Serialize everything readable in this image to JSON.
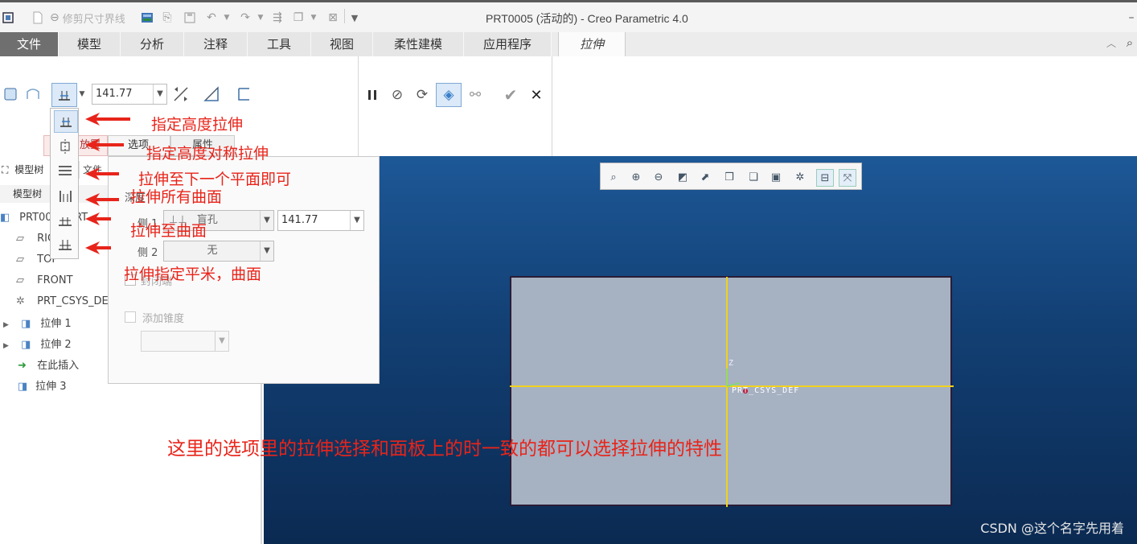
{
  "window": {
    "title": "PRT0005 (活动的) - Creo Parametric 4.0",
    "quick_access_text": "修剪尺寸界线"
  },
  "tabs": [
    {
      "label": "文件"
    },
    {
      "label": "模型"
    },
    {
      "label": "分析"
    },
    {
      "label": "注释"
    },
    {
      "label": "工具"
    },
    {
      "label": "视图"
    },
    {
      "label": "柔性建模"
    },
    {
      "label": "应用程序"
    },
    {
      "label": "拉伸"
    }
  ],
  "ribbon": {
    "depth_value": "141.77",
    "sub_tabs": [
      "放置",
      "选项",
      "属性"
    ]
  },
  "model_tree_header": {
    "title": "模型树",
    "files_tab": "文件",
    "label": "模型树"
  },
  "model_tree": [
    {
      "label": "PRT0005.PRT",
      "icon": "part-icon"
    },
    {
      "label": "RIGHT",
      "icon": "datum-plane-icon"
    },
    {
      "label": "TOP",
      "icon": "datum-plane-icon"
    },
    {
      "label": "FRONT",
      "icon": "datum-plane-icon"
    },
    {
      "label": "PRT_CSYS_DEF",
      "icon": "csys-icon"
    },
    {
      "label": "拉伸 1",
      "icon": "extrude-feature-icon"
    },
    {
      "label": "拉伸 2",
      "icon": "extrude-feature-icon"
    },
    {
      "label": "在此插入",
      "icon": "insert-here-icon"
    },
    {
      "label": "拉伸 3",
      "icon": "extrude-feature-icon"
    }
  ],
  "options_panel": {
    "depth_label": "深度",
    "side1_label": "侧 1",
    "side1_type": "盲孔",
    "side1_value": "141.77",
    "side2_label": "侧 2",
    "side2_type": "无",
    "capped_ends_label": "封闭端",
    "add_taper_label": "添加锥度"
  },
  "viewport": {
    "csys_label": "PRT_CSYS_DEF",
    "axis_label": "Z"
  },
  "annotations": {
    "blind": "指定高度拉伸",
    "symmetric": "指定高度对称拉伸",
    "to_next": "拉伸至下一个平面即可",
    "through_all": "拉伸所有曲面",
    "to_surface": "拉伸至曲面",
    "to_selected": "拉伸指定平米，曲面",
    "note": "这里的选项里的拉伸选择和面板上的时一致的都可以选择拉伸的特性"
  },
  "watermark": "CSDN @这个名字先用着",
  "colors": {
    "annotation": "#e8241a",
    "viewport_top": "#1d5897",
    "viewport_bottom": "#0b2a52",
    "plane_fill": "#a6b1c2",
    "axis_line": "#f2d21c"
  }
}
